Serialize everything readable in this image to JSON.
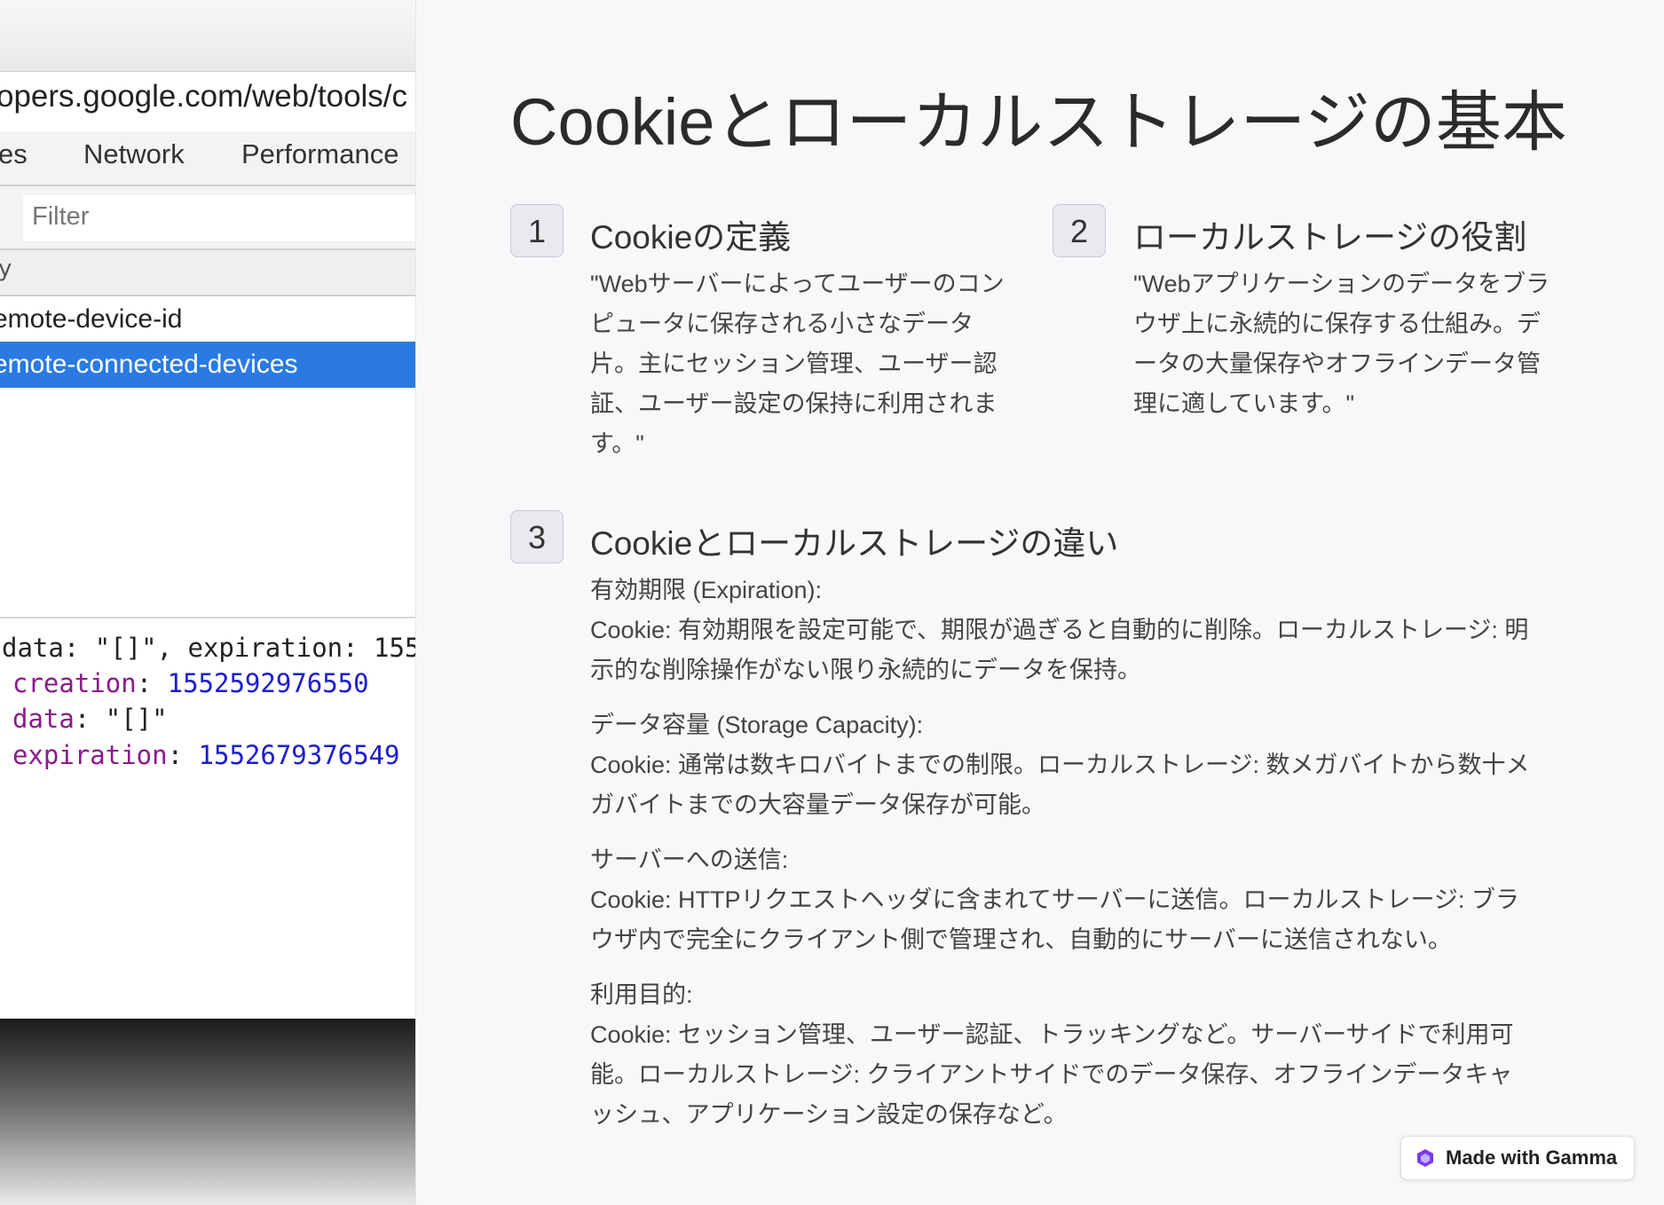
{
  "devtools": {
    "address": "opers.google.com/web/tools/c",
    "tabs": [
      "es",
      "Network",
      "Performance"
    ],
    "filter_placeholder": "Filter",
    "column_header": "y",
    "rows": [
      "emote-device-id",
      "emote-connected-devices"
    ],
    "code": {
      "line1_prefix": "data: \"[]\", expiration: 155",
      "creation_key": "creation",
      "creation_val": "1552592976550",
      "data_key": "data",
      "data_val": "\"[]\"",
      "expiration_key": "expiration",
      "expiration_val": "1552679376549"
    }
  },
  "slide": {
    "title": "Cookieとローカルストレージの基本",
    "items": [
      {
        "number": "1",
        "heading": "Cookieの定義",
        "lines": [
          "\"Webサーバーによってユーザーのコン",
          "ピュータに保存される小さなデータ",
          "片。主にセッション管理、ユーザー認",
          "証、ユーザー設定の保持に利用されま",
          "す。\""
        ]
      },
      {
        "number": "2",
        "heading": "ローカルストレージの役割",
        "lines": [
          "\"Webアプリケーションのデータをブラ",
          "ウザ上に永続的に保存する仕組み。デ",
          "ータの大量保存やオフラインデータ管",
          "理に適しています。\""
        ]
      },
      {
        "number": "3",
        "heading": "Cookieとローカルストレージの違い",
        "sections": [
          {
            "label": "有効期限 (Expiration):",
            "lines": [
              "Cookie: 有効期限を設定可能で、期限が過ぎると自動的に削除。ローカルストレージ: 明",
              "示的な削除操作がない限り永続的にデータを保持。"
            ]
          },
          {
            "label": "データ容量 (Storage Capacity):",
            "lines": [
              "Cookie: 通常は数キロバイトまでの制限。ローカルストレージ: 数メガバイトから数十メ",
              "ガバイトまでの大容量データ保存が可能。"
            ]
          },
          {
            "label": "サーバーへの送信:",
            "lines": [
              "Cookie: HTTPリクエストヘッダに含まれてサーバーに送信。ローカルストレージ: ブラ",
              "ウザ内で完全にクライアント側で管理され、自動的にサーバーに送信されない。"
            ]
          },
          {
            "label": "利用目的:",
            "lines": [
              "Cookie: セッション管理、ユーザー認証、トラッキングなど。サーバーサイドで利用可",
              "能。ローカルストレージ: クライアントサイドでのデータ保存、オフラインデータキャ",
              "ッシュ、アプリケーション設定の保存など。"
            ]
          }
        ]
      }
    ]
  },
  "badge": {
    "label": "Made with Gamma",
    "accent": "#7c3aed"
  }
}
